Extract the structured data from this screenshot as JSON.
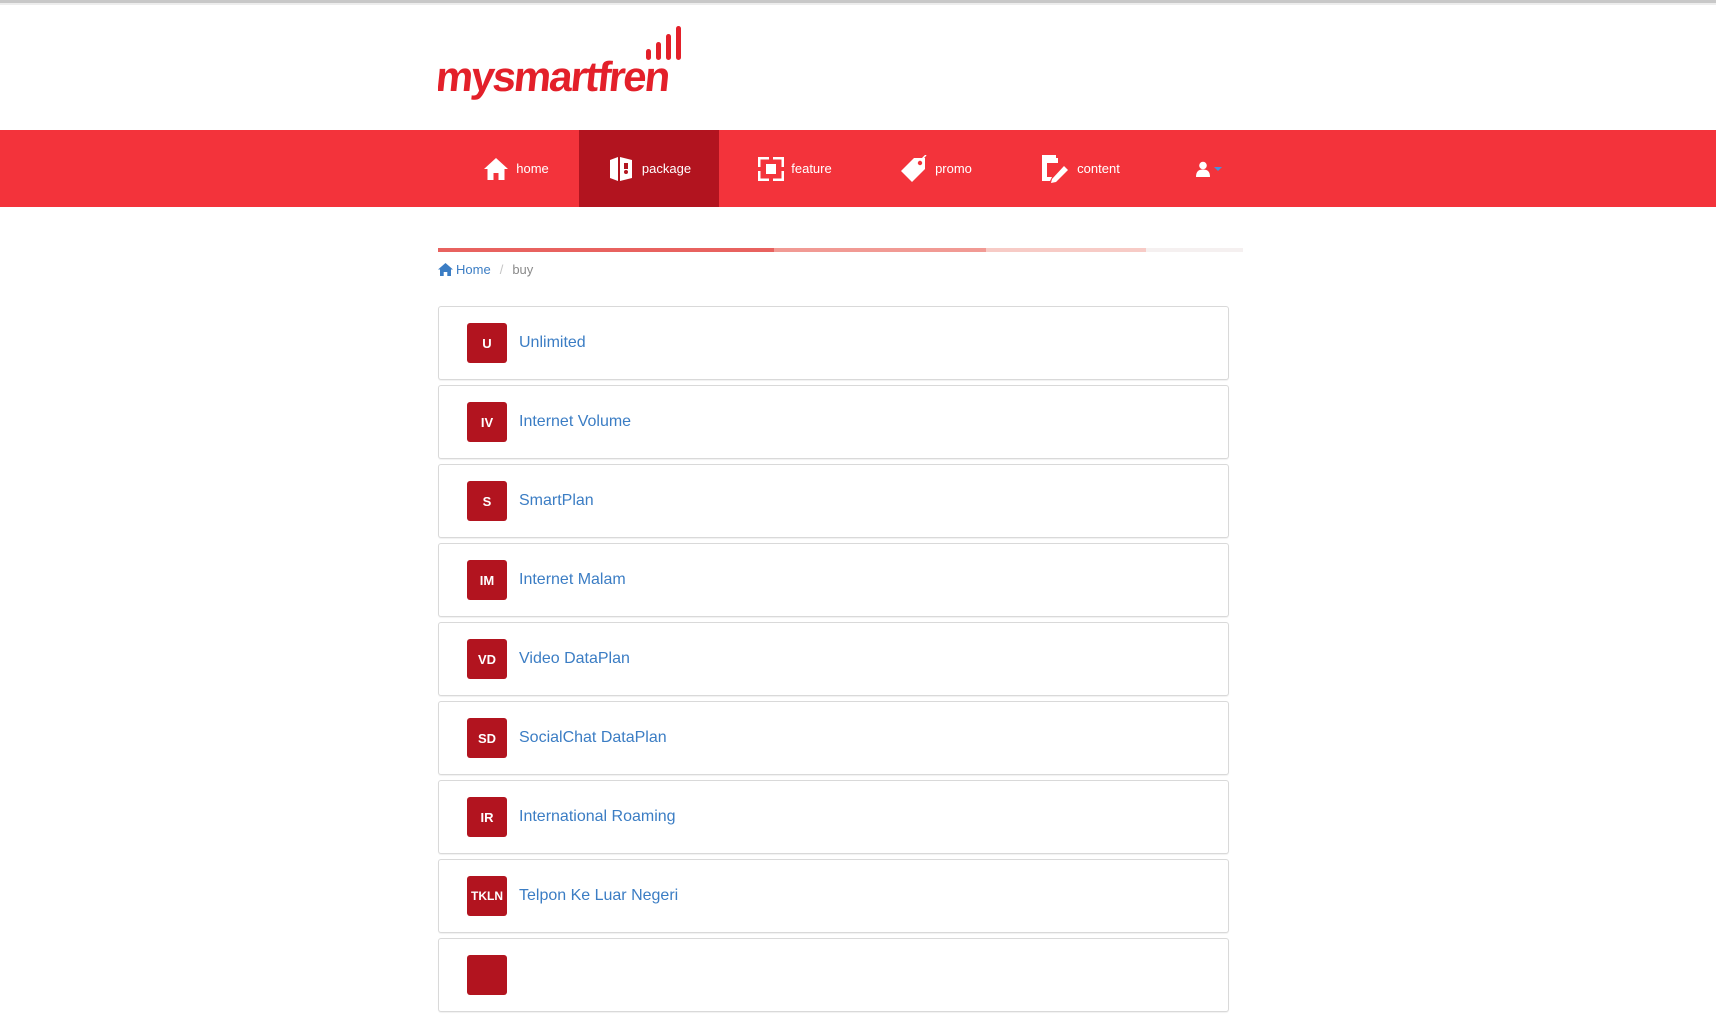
{
  "header": {
    "logo_text": "mysmartfren"
  },
  "nav": {
    "items": [
      {
        "label": "home",
        "icon": "home-icon",
        "active": false
      },
      {
        "label": "package",
        "icon": "package-icon",
        "active": true
      },
      {
        "label": "feature",
        "icon": "feature-icon",
        "active": false
      },
      {
        "label": "promo",
        "icon": "tag-icon",
        "active": false
      },
      {
        "label": "content",
        "icon": "content-icon",
        "active": false
      }
    ],
    "user_icon": "user-icon"
  },
  "breadcrumb": {
    "home": "Home",
    "separator": "/",
    "current": "buy"
  },
  "packages": [
    {
      "badge": "U",
      "label": "Unlimited"
    },
    {
      "badge": "IV",
      "label": "Internet Volume"
    },
    {
      "badge": "S",
      "label": "SmartPlan"
    },
    {
      "badge": "IM",
      "label": "Internet Malam"
    },
    {
      "badge": "VD",
      "label": "Video DataPlan"
    },
    {
      "badge": "SD",
      "label": "SocialChat DataPlan"
    },
    {
      "badge": "IR",
      "label": "International Roaming"
    },
    {
      "badge": "TKLN",
      "label": "Telpon Ke Luar Negeri"
    },
    {
      "badge": "",
      "label": ""
    }
  ],
  "colors": {
    "brand_red": "#f3333b",
    "active_red": "#b2141f",
    "link_blue": "#3b7dc4"
  }
}
